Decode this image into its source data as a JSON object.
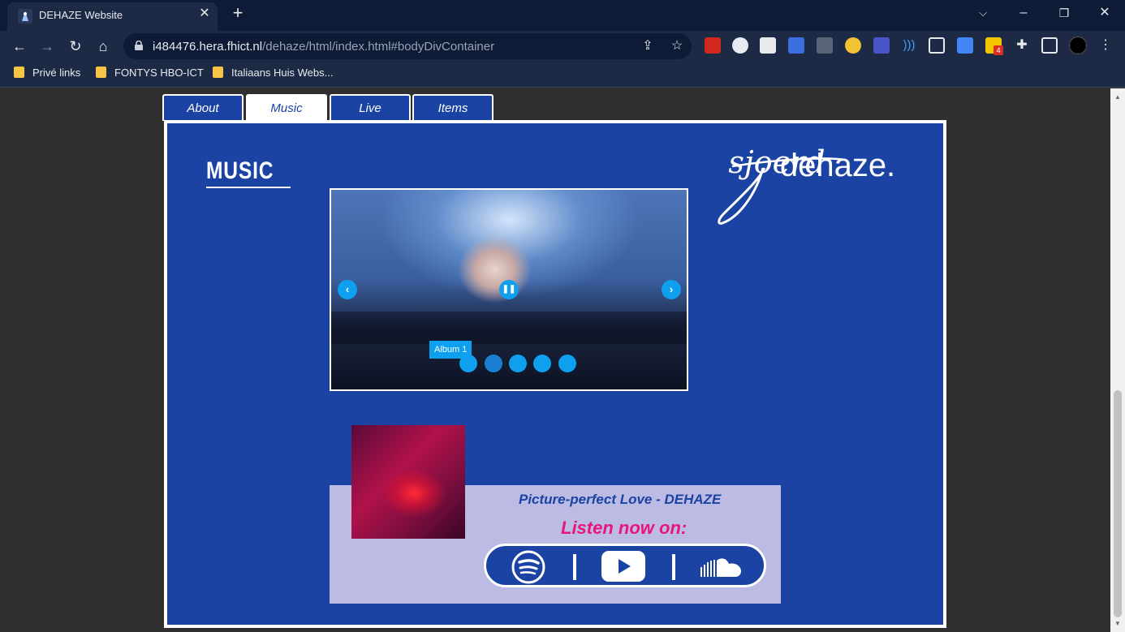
{
  "browser": {
    "tab_title": "DEHAZE Website",
    "url_host": "i484476.hera.fhict.nl",
    "url_path": "/dehaze/html/index.html#bodyDivContainer",
    "bookmarks": [
      "Privé links",
      "FONTYS HBO-ICT",
      "Italiaans Huis Webs..."
    ],
    "extension_badge": "4"
  },
  "nav": {
    "tabs": [
      "About",
      "Music",
      "Live",
      "Items"
    ],
    "active": "Music"
  },
  "page": {
    "heading": "MUSIC",
    "logo_strike": "sjoerd",
    "logo_word": "dehaze."
  },
  "slider": {
    "caption": "Album 1",
    "dot_count": 5,
    "active_dot": 2
  },
  "album": {
    "title": "Picture-perfect Love - DEHAZE",
    "cta": "Listen now on:",
    "platforms": [
      "spotify",
      "youtube",
      "soundcloud"
    ]
  },
  "colors": {
    "panel": "#1a43a3",
    "accent": "#0ea0ef",
    "card": "#bbbbe3",
    "cta": "#e8157a"
  }
}
